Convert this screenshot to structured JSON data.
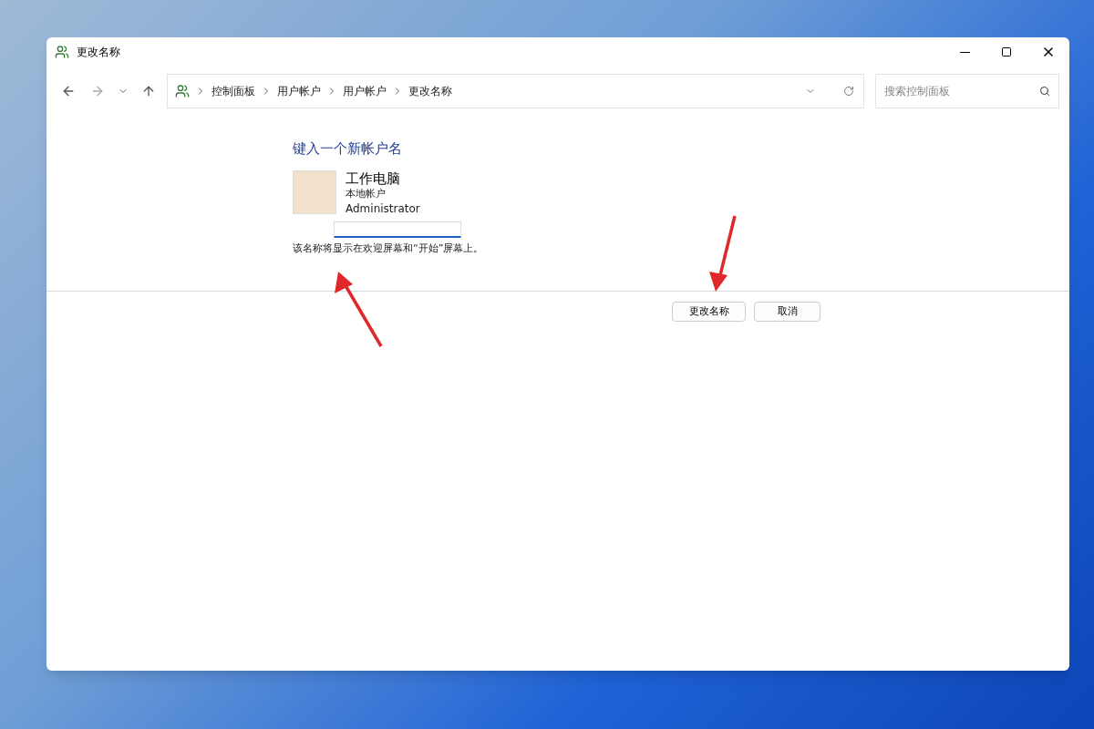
{
  "window": {
    "title": "更改名称"
  },
  "address_bar": {
    "breadcrumb": [
      "控制面板",
      "用户帐户",
      "用户帐户",
      "更改名称"
    ]
  },
  "search": {
    "placeholder": "搜索控制面板"
  },
  "heading": "键入一个新帐户名",
  "account": {
    "name": "工作电脑",
    "type": "本地帐户",
    "role": "Administrator"
  },
  "hint": "该名称将显示在欢迎屏幕和“开始”屏幕上。",
  "buttons": [
    "更改名称",
    "取消"
  ]
}
